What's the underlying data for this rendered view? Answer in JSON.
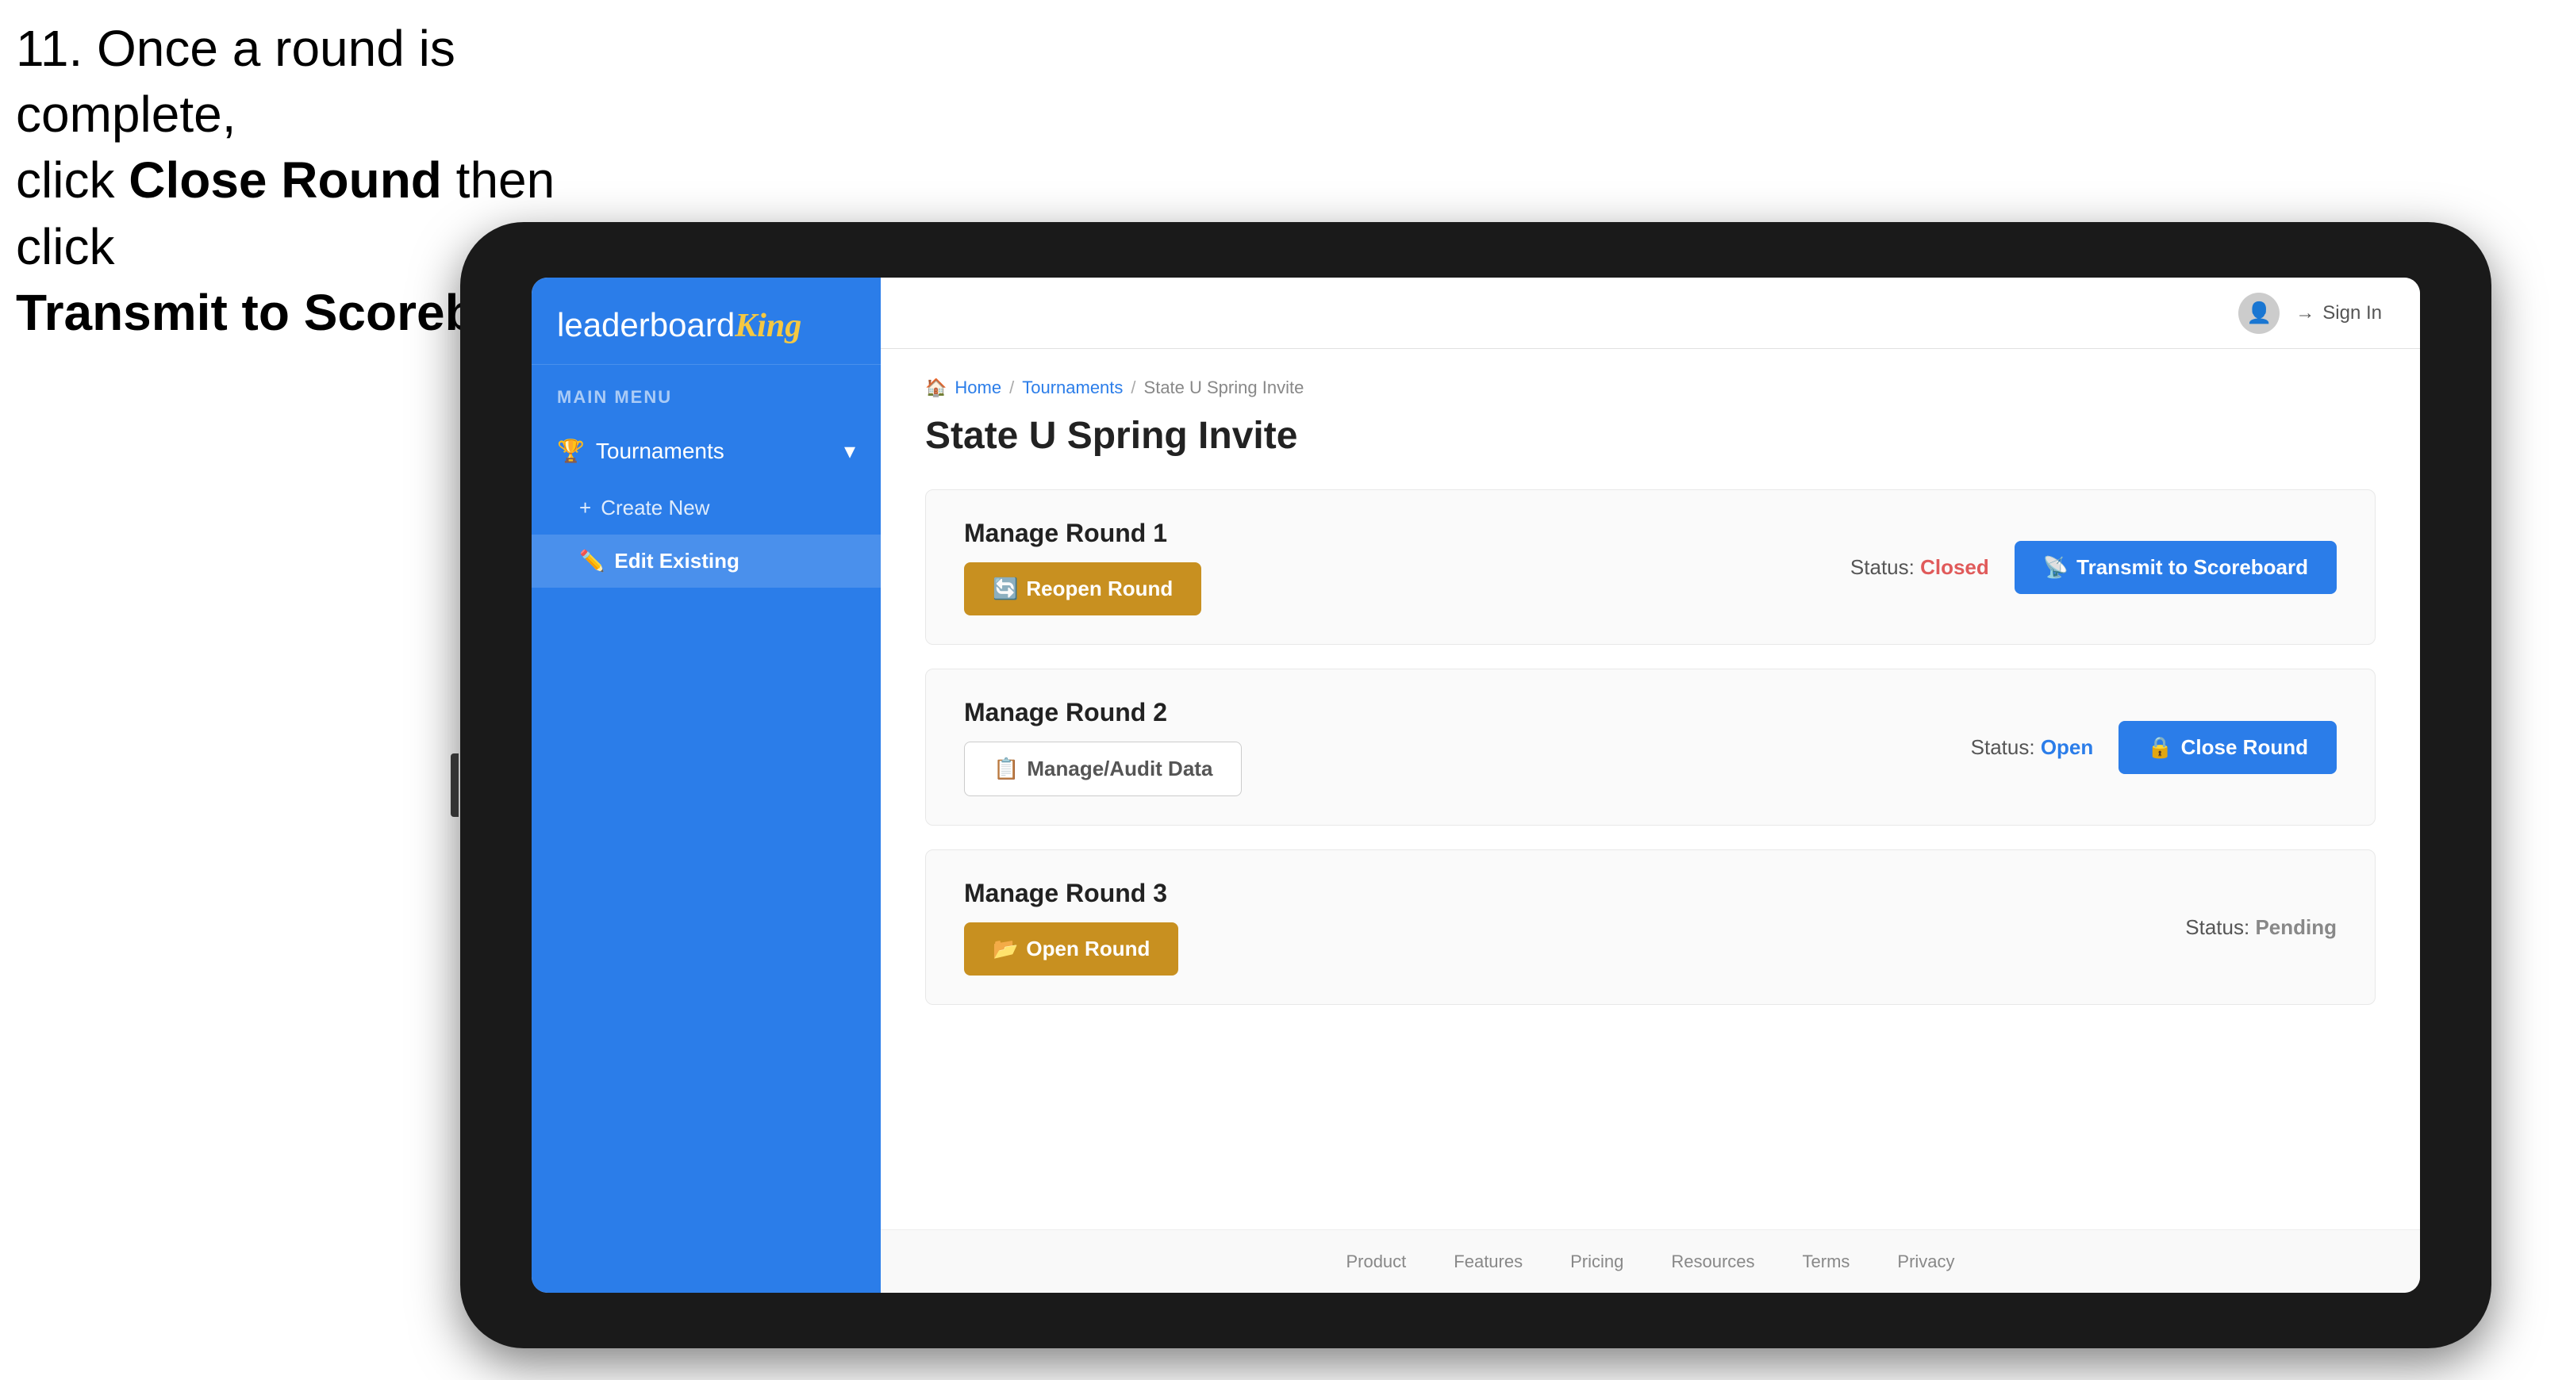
{
  "instruction": {
    "line1": "11. Once a round is complete,",
    "line2": "click ",
    "bold1": "Close Round",
    "line3": " then click",
    "bold2": "Transmit to Scoreboard."
  },
  "header": {
    "sign_in": "Sign In",
    "avatar_icon": "👤"
  },
  "sidebar": {
    "logo_plain": "leaderboard",
    "logo_bold": "King",
    "menu_label": "MAIN MENU",
    "nav_items": [
      {
        "label": "Tournaments",
        "icon": "🏆",
        "expanded": true
      }
    ],
    "sub_items": [
      {
        "label": "Create New",
        "icon": "+",
        "active": false
      },
      {
        "label": "Edit Existing",
        "icon": "✏️",
        "active": true
      }
    ]
  },
  "breadcrumb": {
    "home": "Home",
    "tournaments": "Tournaments",
    "current": "State U Spring Invite"
  },
  "page": {
    "title": "State U Spring Invite"
  },
  "rounds": [
    {
      "label": "Manage Round 1",
      "status_label": "Status:",
      "status_value": "Closed",
      "status_type": "closed",
      "buttons": [
        {
          "label": "Reopen Round",
          "style": "gold",
          "icon": "🔄"
        },
        {
          "label": "Transmit to Scoreboard",
          "style": "blue",
          "icon": "📡"
        }
      ]
    },
    {
      "label": "Manage Round 2",
      "status_label": "Status:",
      "status_value": "Open",
      "status_type": "open",
      "buttons": [
        {
          "label": "Manage/Audit Data",
          "style": "outline",
          "icon": "📋"
        },
        {
          "label": "Close Round",
          "style": "blue",
          "icon": "🔒"
        }
      ]
    },
    {
      "label": "Manage Round 3",
      "status_label": "Status:",
      "status_value": "Pending",
      "status_type": "pending",
      "buttons": [
        {
          "label": "Open Round",
          "style": "gold",
          "icon": "📂"
        }
      ]
    }
  ],
  "footer": {
    "links": [
      "Product",
      "Features",
      "Pricing",
      "Resources",
      "Terms",
      "Privacy"
    ]
  }
}
